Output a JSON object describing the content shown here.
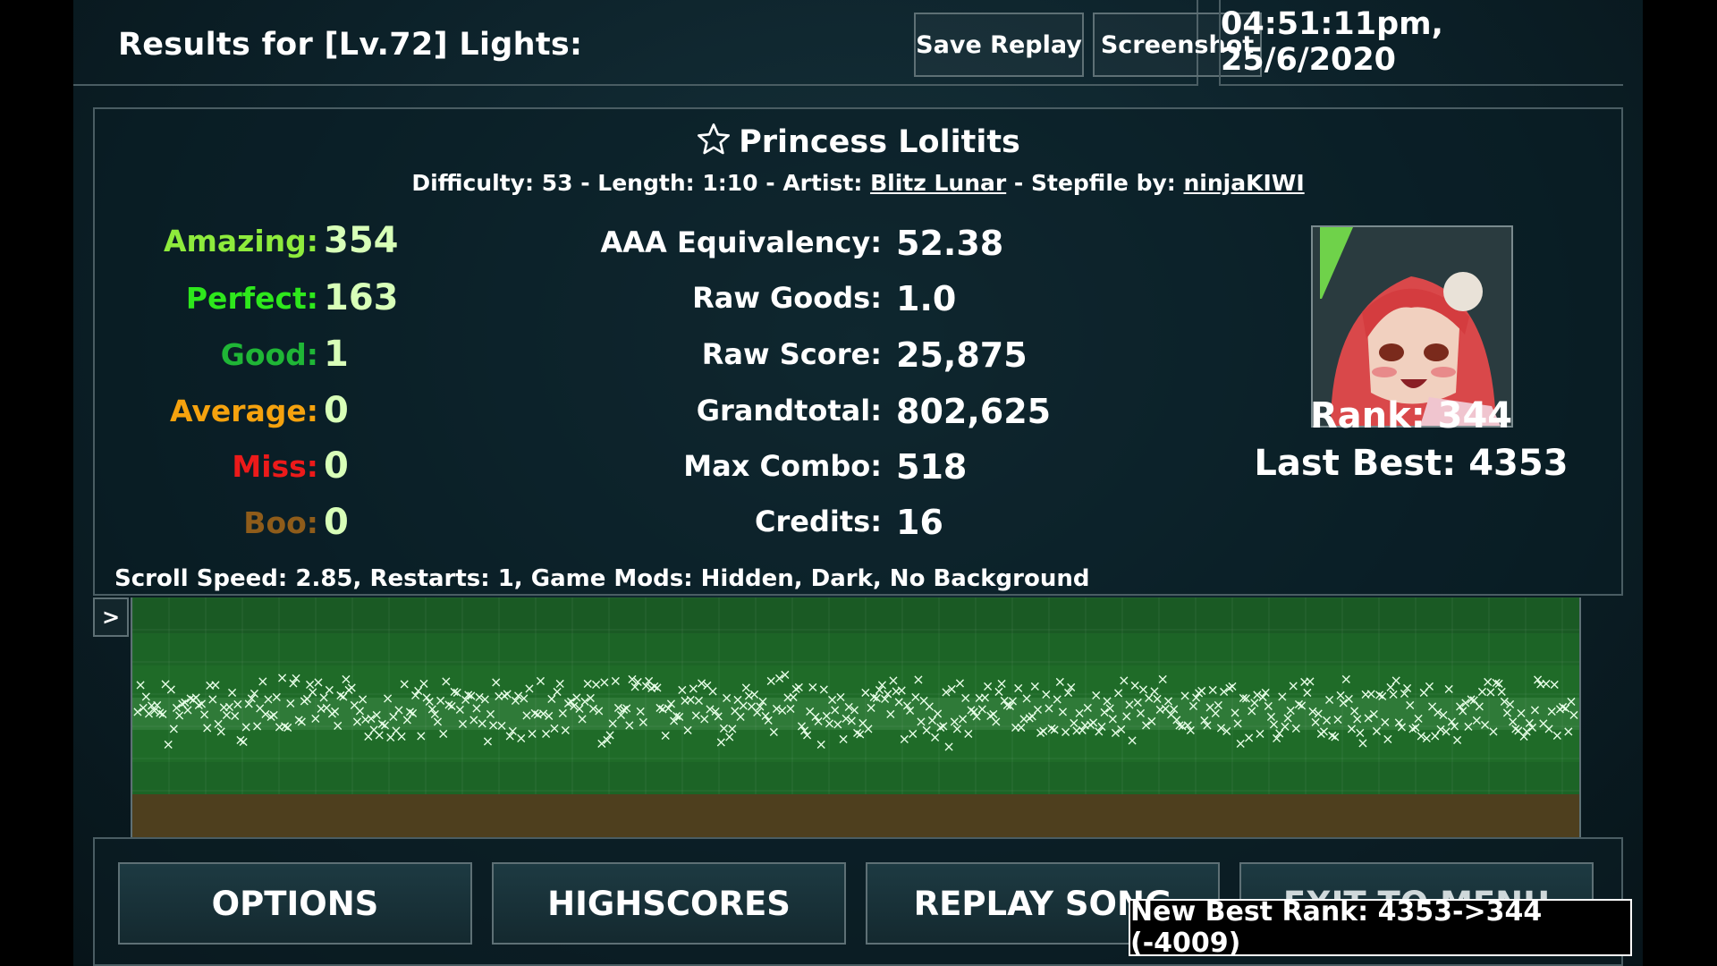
{
  "header": {
    "results_title": "Results for [Lv.72] Lights:",
    "save_replay_label": "Save Replay",
    "screenshot_label": "Screenshot",
    "datetime": "04:51:11pm, 25/6/2020"
  },
  "song": {
    "name": "Princess Lolitits",
    "difficulty_label": "Difficulty:",
    "difficulty": "53",
    "length_label": "Length:",
    "length": "1:10",
    "artist_label": "Artist:",
    "artist": "Blitz Lunar",
    "stepfile_label": "Stepfile by:",
    "stepfile_author": "ninjaKIWI",
    "separator": " - "
  },
  "judgements": [
    {
      "label": "Amazing:",
      "value": "354",
      "color": "#8eeb3c"
    },
    {
      "label": "Perfect:",
      "value": "163",
      "color": "#2ee81c"
    },
    {
      "label": "Good:",
      "value": "1",
      "color": "#1fb636"
    },
    {
      "label": "Average:",
      "value": "0",
      "color": "#f5a20e"
    },
    {
      "label": "Miss:",
      "value": "0",
      "color": "#ec1a1a"
    },
    {
      "label": "Boo:",
      "value": "0",
      "color": "#8f5c1a"
    }
  ],
  "value_color": "#d8ffb8",
  "stats": [
    {
      "label": "AAA Equivalency:",
      "value": "52.38"
    },
    {
      "label": "Raw Goods:",
      "value": "1.0"
    },
    {
      "label": "Raw Score:",
      "value": "25,875"
    },
    {
      "label": "Grandtotal:",
      "value": "802,625"
    },
    {
      "label": "Max Combo:",
      "value": "518"
    },
    {
      "label": "Credits:",
      "value": "16"
    }
  ],
  "rank": {
    "rank_text": "Rank: 344",
    "last_best_text": "Last Best: 4353"
  },
  "settings_line": "Scroll Speed: 2.85, Restarts: 1, Game Mods: Hidden, Dark, No Background",
  "graph": {
    "toggle_label": ">"
  },
  "buttons": {
    "options": "OPTIONS",
    "highscores": "HIGHSCORES",
    "replay": "REPLAY SONG",
    "exit": "EXIT TO MENU"
  },
  "notification": "New Best Rank: 4353->344 (-4009)",
  "colors": {
    "background": "#0c2129",
    "border": "#4a5d63",
    "graph_green": "#1f6b28",
    "graph_bottom": "#4e3f1e"
  }
}
